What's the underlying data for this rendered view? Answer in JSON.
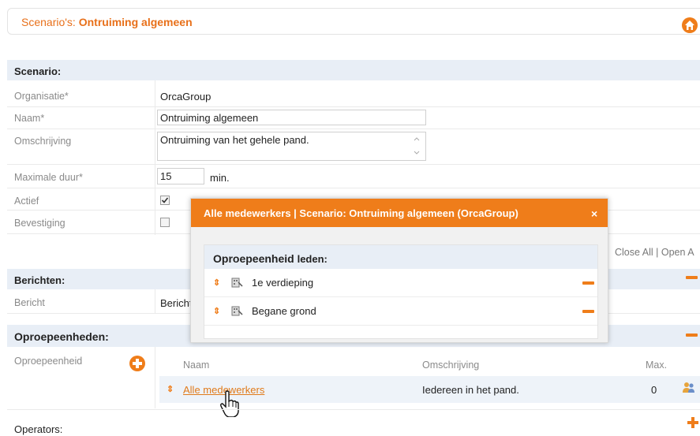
{
  "header": {
    "prefix": "Scenario's: ",
    "title": "Ontruiming algemeen"
  },
  "scenario": {
    "section_title": "Scenario:",
    "fields": {
      "organisatie": {
        "label": "Organisatie*",
        "value": "OrcaGroup"
      },
      "naam": {
        "label": "Naam*",
        "value": "Ontruiming algemeen"
      },
      "omschrijving": {
        "label": "Omschrijving",
        "value": "Ontruiming van het gehele pand."
      },
      "maximale_duur": {
        "label": "Maximale duur*",
        "value": "15",
        "unit": "min."
      },
      "actief": {
        "label": "Actief",
        "checked": true
      },
      "bevestiging": {
        "label": "Bevestiging",
        "checked": false
      }
    }
  },
  "links": {
    "close_all": "Close All",
    "separator": " | ",
    "open_all": "Open A"
  },
  "berichten": {
    "section_title": "Berichten:",
    "label": "Bericht",
    "value": "Bericht"
  },
  "oproepeenheden": {
    "section_title": "Oproepeenheden:",
    "label": "Oproepeenheid",
    "columns": {
      "naam": "Naam",
      "omschrijving": "Omschrijving",
      "max": "Max."
    },
    "rows": [
      {
        "naam": "Alle medewerkers",
        "omschrijving": "Iedereen in het pand.",
        "max": "0"
      }
    ]
  },
  "operators": {
    "section_title": "Operators:"
  },
  "modal": {
    "title": "Alle medewerkers | Scenario: Ontruiming algemeen (OrcaGroup)",
    "close": "×",
    "panel_title": "Oproepeenheid",
    "panel_subtitle": "leden:",
    "members": [
      {
        "name": "1e verdieping"
      },
      {
        "name": "Begane grond"
      }
    ]
  },
  "colors": {
    "accent": "#ef7d1a",
    "section_bg": "#e8eef6",
    "link": "#e07a1a"
  }
}
